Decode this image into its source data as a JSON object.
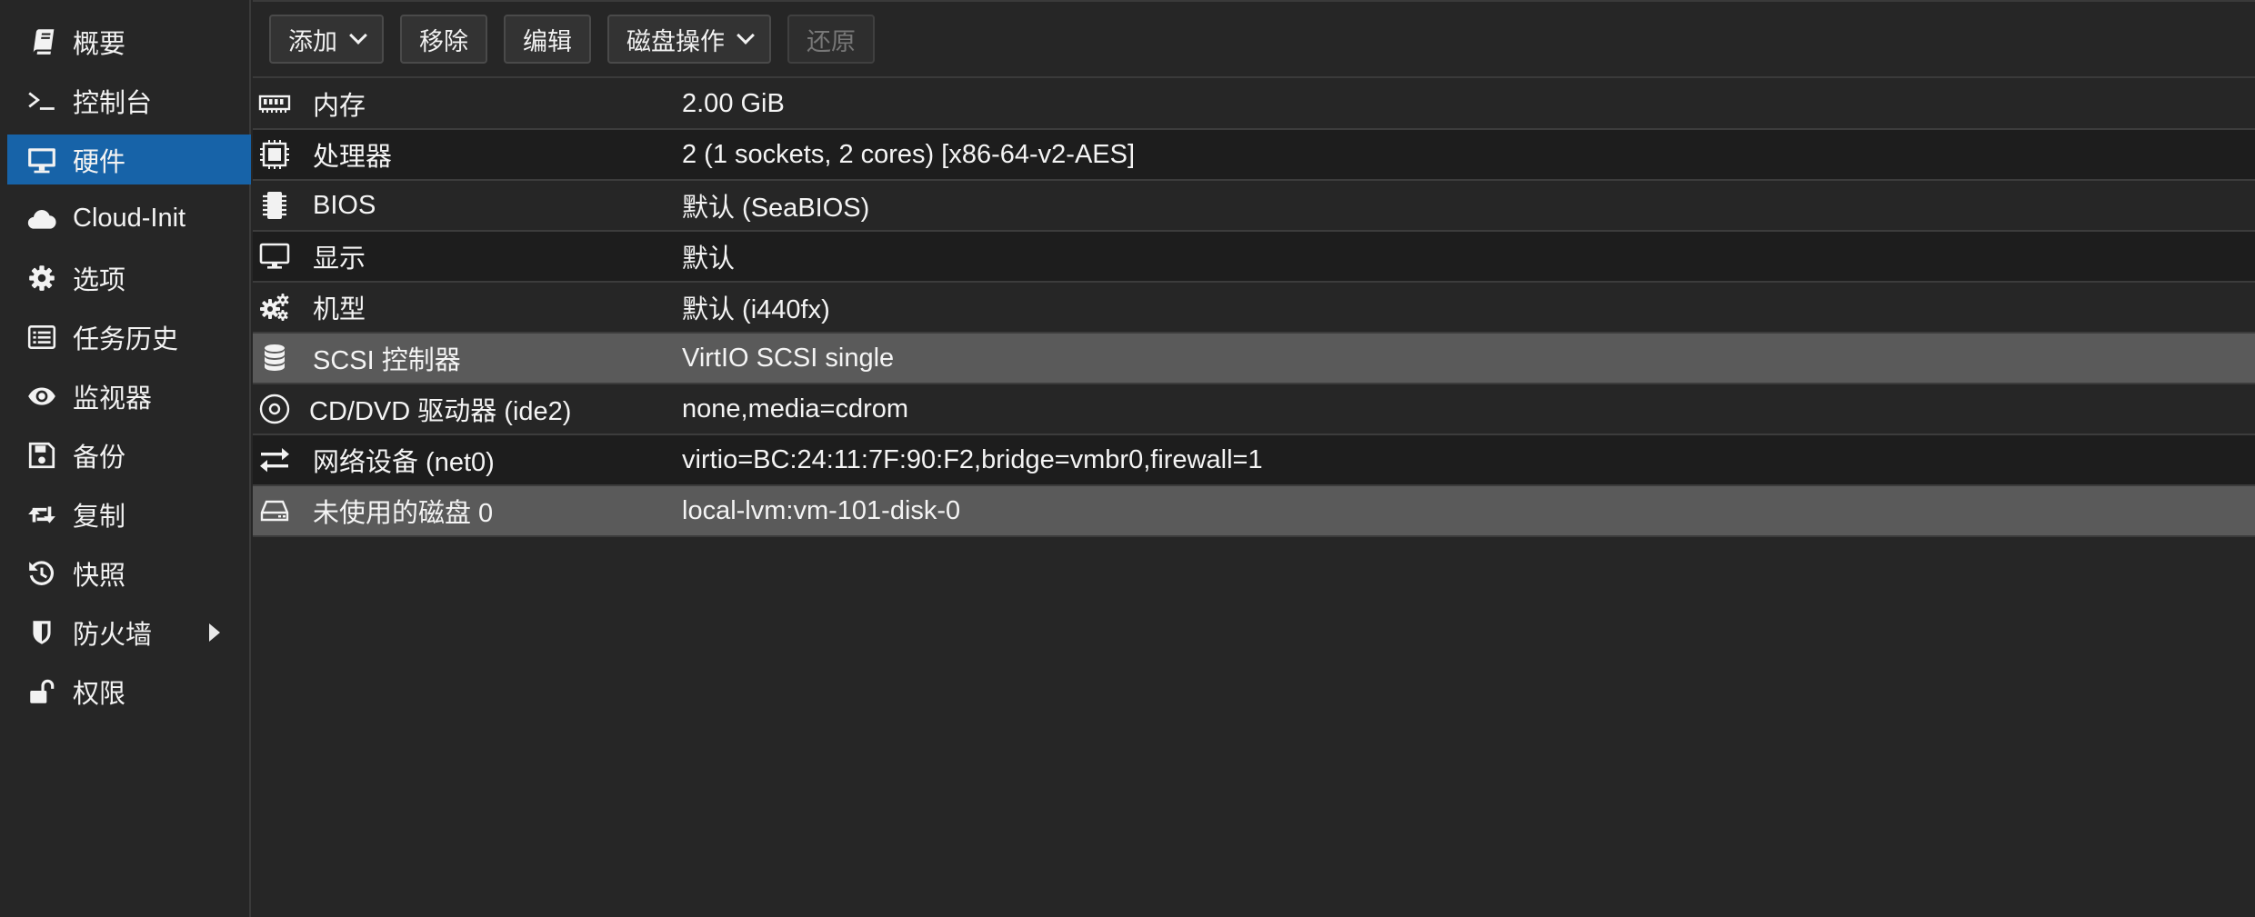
{
  "colors": {
    "background": "#262626",
    "active_nav": "#1763a8",
    "selected_row": "#5a5a5a",
    "alt_row": "#1d1d1d"
  },
  "sidebar": {
    "items": [
      {
        "label": "概要",
        "icon": "book-icon"
      },
      {
        "label": "控制台",
        "icon": "terminal-icon"
      },
      {
        "label": "硬件",
        "icon": "monitor-icon",
        "active": true
      },
      {
        "label": "Cloud-Init",
        "icon": "cloud-icon"
      },
      {
        "label": "选项",
        "icon": "gear-icon"
      },
      {
        "label": "任务历史",
        "icon": "list-icon"
      },
      {
        "label": "监视器",
        "icon": "eye-icon"
      },
      {
        "label": "备份",
        "icon": "floppy-icon"
      },
      {
        "label": "复制",
        "icon": "retweet-icon"
      },
      {
        "label": "快照",
        "icon": "history-icon"
      },
      {
        "label": "防火墙",
        "icon": "shield-icon",
        "expandable": true
      },
      {
        "label": "权限",
        "icon": "unlock-icon"
      }
    ]
  },
  "toolbar": {
    "add_label": "添加",
    "remove_label": "移除",
    "edit_label": "编辑",
    "disk_action_label": "磁盘操作",
    "revert_label": "还原"
  },
  "hardware": {
    "rows": [
      {
        "name": "内存",
        "value": "2.00 GiB",
        "icon": "memory-icon"
      },
      {
        "name": "处理器",
        "value": "2 (1 sockets, 2 cores) [x86-64-v2-AES]",
        "icon": "cpu-icon"
      },
      {
        "name": "BIOS",
        "value": "默认 (SeaBIOS)",
        "icon": "microchip-icon"
      },
      {
        "name": "显示",
        "value": "默认",
        "icon": "desktop-icon"
      },
      {
        "name": "机型",
        "value": "默认 (i440fx)",
        "icon": "cogs-icon"
      },
      {
        "name": "SCSI 控制器",
        "value": "VirtIO SCSI single",
        "icon": "database-icon",
        "selected": true
      },
      {
        "name": "CD/DVD 驱动器 (ide2)",
        "value": "none,media=cdrom",
        "icon": "cdrom-icon"
      },
      {
        "name": "网络设备 (net0)",
        "value": "virtio=BC:24:11:7F:90:F2,bridge=vmbr0,firewall=1",
        "icon": "exchange-icon"
      },
      {
        "name": "未使用的磁盘 0",
        "value": "local-lvm:vm-101-disk-0",
        "icon": "hdd-icon",
        "selected": true
      }
    ]
  }
}
